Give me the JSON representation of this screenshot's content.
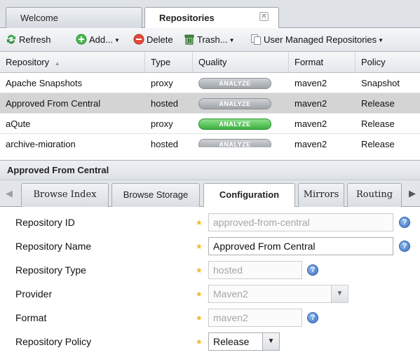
{
  "tabs": [
    {
      "label": "Welcome",
      "active": false
    },
    {
      "label": "Repositories",
      "active": true,
      "close_glyph": "✕"
    }
  ],
  "toolbar": {
    "refresh": "Refresh",
    "add": "Add...",
    "delete": "Delete",
    "trash": "Trash...",
    "user_managed": "User Managed Repositories",
    "caret": "▼"
  },
  "grid": {
    "columns": [
      "Repository",
      "Type",
      "Quality",
      "Format",
      "Policy"
    ],
    "sort_indicator": "▲",
    "rows": [
      {
        "repository": "Apache Snapshots",
        "type": "proxy",
        "quality": "ANALYZE",
        "quality_on": false,
        "format": "maven2",
        "policy": "Snapshot",
        "selected": false
      },
      {
        "repository": "Approved From Central",
        "type": "hosted",
        "quality": "ANALYZE",
        "quality_on": false,
        "format": "maven2",
        "policy": "Release",
        "selected": true
      },
      {
        "repository": "aQute",
        "type": "proxy",
        "quality": "ANALYZE",
        "quality_on": true,
        "format": "maven2",
        "policy": "Release",
        "selected": false
      },
      {
        "repository": "archive-migration",
        "type": "hosted",
        "quality": "ANALYZE",
        "quality_on": false,
        "format": "maven2",
        "policy": "Release",
        "selected": false
      }
    ]
  },
  "panel": {
    "title": "Approved From Central",
    "scroll_left": "◀",
    "scroll_right": "▶",
    "subtabs": [
      "Browse Index",
      "Browse Storage",
      "Configuration",
      "Mirrors",
      "Routing"
    ],
    "active_subtab": "Configuration"
  },
  "form": {
    "required_mark": "★",
    "help_glyph": "?",
    "select_caret": "▼",
    "repository_id": {
      "label": "Repository ID",
      "value": "approved-from-central"
    },
    "repository_name": {
      "label": "Repository Name",
      "value": "Approved From Central"
    },
    "repository_type": {
      "label": "Repository Type",
      "value": "hosted"
    },
    "provider": {
      "label": "Provider",
      "value": "Maven2"
    },
    "format": {
      "label": "Format",
      "value": "maven2"
    },
    "repository_policy": {
      "label": "Repository Policy",
      "value": "Release"
    }
  },
  "colors": {
    "analyze_on": "#3bb13d",
    "analyze_off": "#9ea3a8",
    "selected_row": "#d4d4d4",
    "required_star": "#f0b72c",
    "help_icon": "#3d74c6"
  }
}
